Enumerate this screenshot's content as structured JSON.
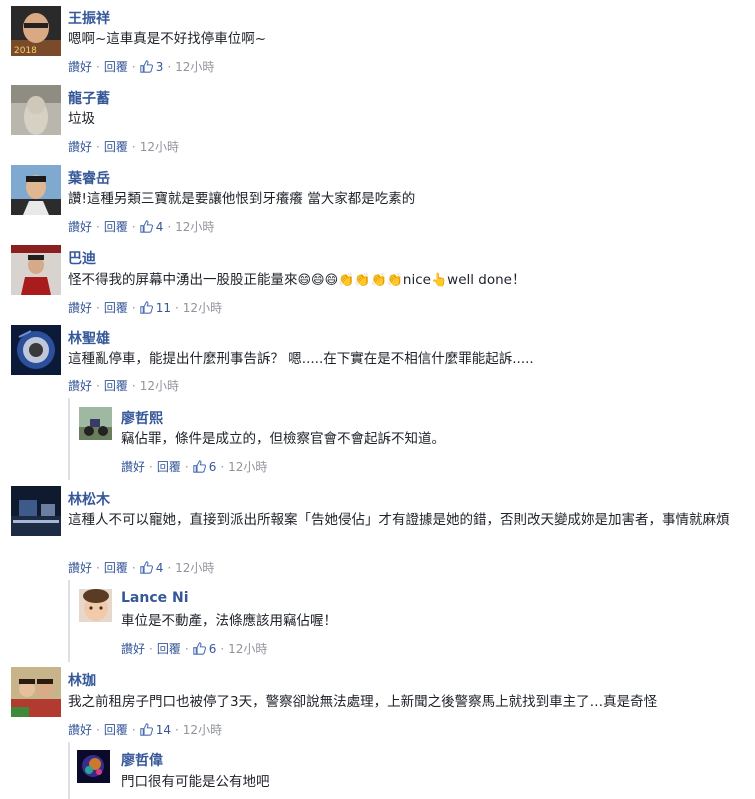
{
  "actions": {
    "like": "讚好",
    "reply": "回覆",
    "dot": "·"
  },
  "comments": [
    {
      "name": "王振祥",
      "text": "嗯啊~這車真是不好找停車位啊~",
      "likes": "3",
      "time": "12小時"
    },
    {
      "name": "龍子蓄",
      "text": "垃圾",
      "time": "12小時"
    },
    {
      "name": "葉睿岳",
      "text": "讚!這種另類三寶就是要讓他恨到牙癢癢 當大家都是吃素的",
      "likes": "4",
      "time": "12小時"
    },
    {
      "name": "巴迪",
      "text_before": "怪不得我的屏幕中湧出一股股正能量來",
      "text_mid": "nice",
      "text_after": "well done！",
      "likes": "11",
      "time": "12小時"
    },
    {
      "name": "林聖雄",
      "text": "這種亂停車，能提出什麼刑事告訴？ 嗯.....在下實在是不相信什麼罪能起訴.....",
      "time": "12小時"
    },
    {
      "name": "廖哲熙",
      "text": "竊佔罪，條件是成立的，但檢察官會不會起訴不知道。",
      "likes": "6",
      "time": "12小時"
    },
    {
      "name": "林松木",
      "text": "這種人不可以寵她，直接到派出所報案「告她侵佔」才有證據是她的錯，否則改天變成妳是加害者，事情就麻煩",
      "likes": "4",
      "time": "12小時"
    },
    {
      "name": "Lance Ni",
      "text": "車位是不動產，法條應該用竊佔喔！",
      "likes": "6",
      "time": "12小時"
    },
    {
      "name": "林珈",
      "text": "我之前租房子門口也被停了3天，警察卻說無法處理，上新聞之後警察馬上就找到車主了…真是奇怪",
      "likes": "14",
      "time": "12小時"
    },
    {
      "name": "廖哲偉",
      "text": "門口很有可能是公有地吧"
    }
  ],
  "colors": {
    "name": "#365899",
    "text": "#1d2129",
    "meta": "#90949c",
    "thread_line": "#dddfe2"
  },
  "icons": {
    "like": "thumbs-up-icon",
    "grin": "grinning-face-emoji",
    "clap": "clapping-hands-emoji",
    "point": "pointing-hand-emoji"
  }
}
